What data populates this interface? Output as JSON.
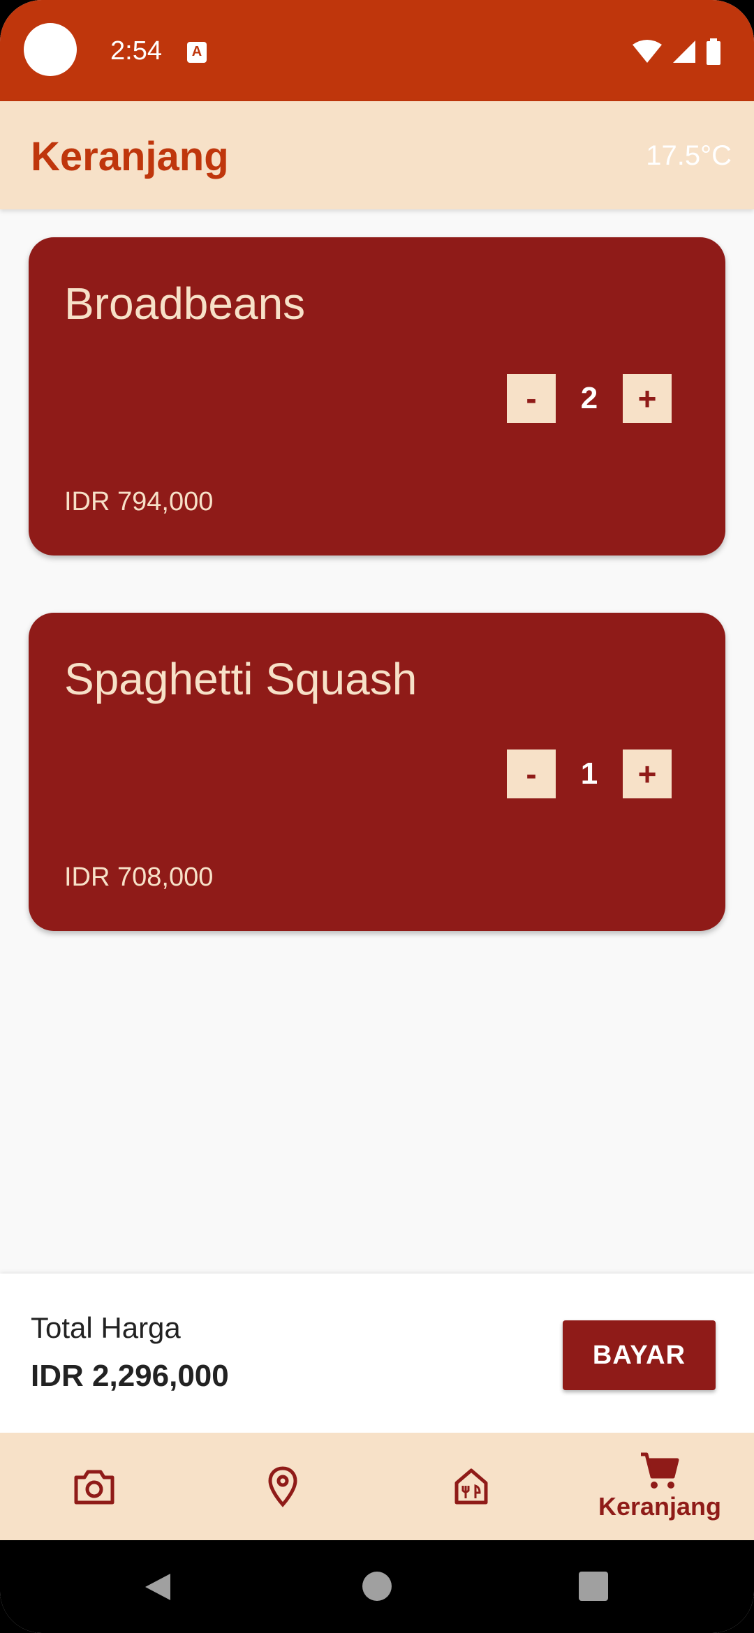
{
  "status_bar": {
    "time": "2:54",
    "notification_icon": "A"
  },
  "app_bar": {
    "title": "Keranjang",
    "temperature": "17.5°C"
  },
  "cart": {
    "items": [
      {
        "name": "Broadbeans",
        "quantity": "2",
        "price": "IDR 794,000",
        "minus_label": "-",
        "plus_label": "+"
      },
      {
        "name": "Spaghetti Squash",
        "quantity": "1",
        "price": "IDR 708,000",
        "minus_label": "-",
        "plus_label": "+"
      }
    ]
  },
  "total": {
    "label": "Total Harga",
    "value": "IDR 2,296,000",
    "pay_label": "BAYAR"
  },
  "bottom_nav": {
    "items": [
      {
        "icon": "camera-icon"
      },
      {
        "icon": "location-pin-icon"
      },
      {
        "icon": "restaurant-icon"
      },
      {
        "icon": "cart-icon",
        "label": "Keranjang",
        "active": true
      }
    ]
  },
  "colors": {
    "primary": "#bf360c",
    "card": "#8f1b18",
    "cream": "#f7e1c8"
  }
}
